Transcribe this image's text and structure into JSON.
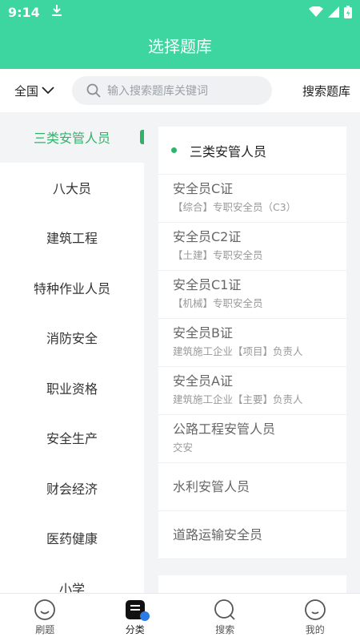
{
  "status": {
    "time": "9:14"
  },
  "header": {
    "title": "选择题库"
  },
  "search": {
    "region": "全国",
    "placeholder": "输入搜索题库关键词",
    "button": "搜索题库"
  },
  "sidebar": {
    "items": [
      {
        "label": "三类安管人员",
        "active": true
      },
      {
        "label": "八大员"
      },
      {
        "label": "建筑工程"
      },
      {
        "label": "特种作业人员"
      },
      {
        "label": "消防安全"
      },
      {
        "label": "职业资格"
      },
      {
        "label": "安全生产"
      },
      {
        "label": "财会经济"
      },
      {
        "label": "医药健康"
      },
      {
        "label": "小学"
      }
    ]
  },
  "content": {
    "section_title": "三类安管人员",
    "items": [
      {
        "title": "安全员C证",
        "sub": "【综合】专职安全员（C3）"
      },
      {
        "title": "安全员C2证",
        "sub": "【土建】专职安全员"
      },
      {
        "title": "安全员C1证",
        "sub": "【机械】专职安全员"
      },
      {
        "title": "安全员B证",
        "sub": "建筑施工企业【项目】负责人"
      },
      {
        "title": "安全员A证",
        "sub": "建筑施工企业【主要】负责人"
      },
      {
        "title": "公路工程安管人员",
        "sub": "交安"
      },
      {
        "title": "水利安管人员"
      },
      {
        "title": "道路运输安全员"
      }
    ]
  },
  "tabbar": {
    "items": [
      {
        "label": "刷题",
        "icon": "face-icon"
      },
      {
        "label": "分类",
        "icon": "category-icon",
        "active": true
      },
      {
        "label": "搜索",
        "icon": "search-icon"
      },
      {
        "label": "我的",
        "icon": "profile-icon"
      }
    ]
  },
  "colors": {
    "accent": "#3dd6a0",
    "active_text": "#2fb36a"
  }
}
